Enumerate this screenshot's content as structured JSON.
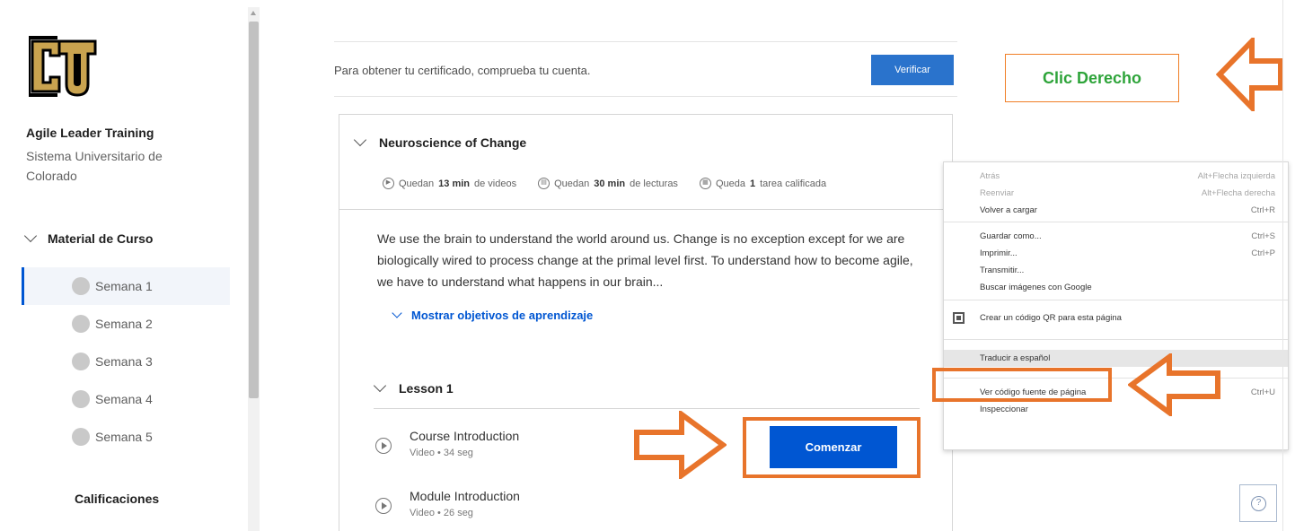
{
  "sidebar": {
    "course_title": "Agile Leader Training",
    "course_org": "Sistema Universitario de Colorado",
    "section_header": "Material de Curso",
    "weeks": [
      "Semana 1",
      "Semana 2",
      "Semana 3",
      "Semana 4",
      "Semana 5"
    ],
    "active_week": "Semana 1",
    "grades_label": "Calificaciones"
  },
  "certificate": {
    "text": "Para obtener tu certificado, comprueba tu cuenta.",
    "button_label": "Verificar"
  },
  "module": {
    "title": "Neuroscience of Change",
    "meta": {
      "videos_prefix": "Quedan",
      "videos_value": "13 min",
      "videos_suffix": "de videos",
      "readings_prefix": "Quedan",
      "readings_value": "30 min",
      "readings_suffix": "de lecturas",
      "graded_prefix": "Queda",
      "graded_value": "1",
      "graded_suffix": "tarea calificada"
    },
    "description": "We use the brain to understand the world around us. Change is no exception except for we are biologically wired to process change at the primal level first. To understand how to become agile, we have to understand what happens in our brain...",
    "objectives_link": "Mostrar objetivos de aprendizaje",
    "lesson_title": "Lesson 1",
    "items": [
      {
        "title": "Course Introduction",
        "sub": "Video • 34 seg"
      },
      {
        "title": "Module Introduction",
        "sub": "Video • 26 seg"
      }
    ],
    "start_button": "Comenzar"
  },
  "annotation": {
    "label": "Clic Derecho"
  },
  "context_menu": {
    "groups": [
      [
        {
          "label": "Atrás",
          "shortcut": "Alt+Flecha izquierda",
          "disabled": true
        },
        {
          "label": "Reenviar",
          "shortcut": "Alt+Flecha derecha",
          "disabled": true
        },
        {
          "label": "Volver a cargar",
          "shortcut": "Ctrl+R",
          "disabled": false
        }
      ],
      [
        {
          "label": "Guardar como...",
          "shortcut": "Ctrl+S",
          "disabled": false
        },
        {
          "label": "Imprimir...",
          "shortcut": "Ctrl+P",
          "disabled": false
        },
        {
          "label": "Transmitir...",
          "shortcut": "",
          "disabled": false
        },
        {
          "label": "Buscar imágenes con Google",
          "shortcut": "",
          "disabled": false
        }
      ],
      [
        {
          "label": "Crear un código QR para esta página",
          "shortcut": "",
          "disabled": false,
          "icon": "qr-code-icon"
        }
      ],
      [
        {
          "label": "Traducir a español",
          "shortcut": "",
          "disabled": false,
          "highlight": true
        }
      ],
      [
        {
          "label": "Ver código fuente de página",
          "shortcut": "Ctrl+U",
          "disabled": false
        },
        {
          "label": "Inspeccionar",
          "shortcut": "",
          "disabled": false
        }
      ]
    ]
  },
  "colors": {
    "accent": "#0056d2",
    "annotation_orange": "#e8742b",
    "annotation_text": "#2ea43a"
  }
}
